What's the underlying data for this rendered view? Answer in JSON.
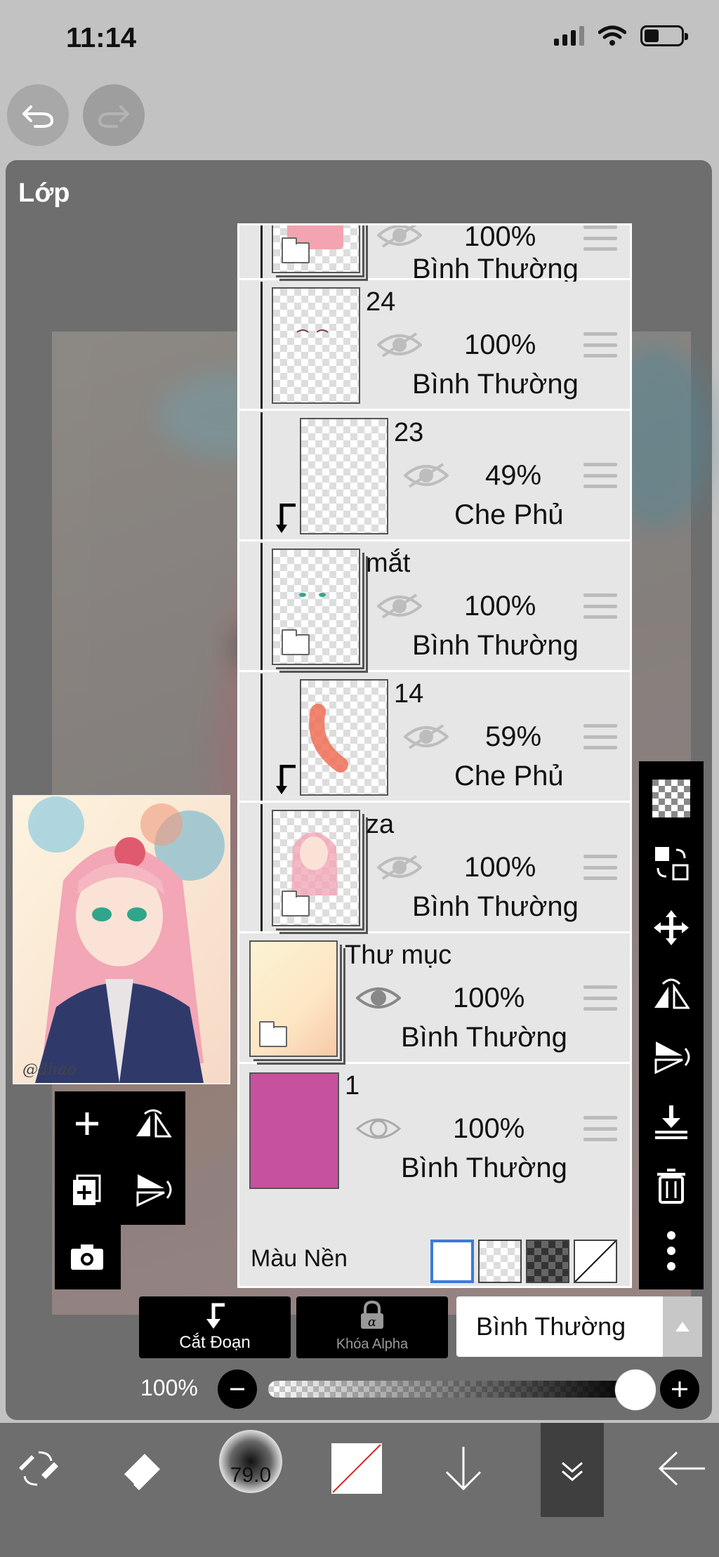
{
  "status": {
    "time": "11:14"
  },
  "panel": {
    "title": "Lớp"
  },
  "layers": [
    {
      "name": "",
      "opacity": "100%",
      "blend": "Bình Thường"
    },
    {
      "name": "24",
      "opacity": "100%",
      "blend": "Bình Thường"
    },
    {
      "name": "23",
      "opacity": "49%",
      "blend": "Che Phủ"
    },
    {
      "name": "mắt",
      "opacity": "100%",
      "blend": "Bình Thường"
    },
    {
      "name": "14",
      "opacity": "59%",
      "blend": "Che Phủ"
    },
    {
      "name": "za",
      "opacity": "100%",
      "blend": "Bình Thường"
    },
    {
      "name": "Thư mục",
      "opacity": "100%",
      "blend": "Bình Thường"
    },
    {
      "name": "1",
      "opacity": "100%",
      "blend": "Bình Thường"
    }
  ],
  "background": {
    "label": "Màu Nền"
  },
  "controls": {
    "clip_label": "Cắt Đoạn",
    "alpha_label": "Khóa Alpha",
    "blend_value": "Bình Thường",
    "opacity_value": "100%"
  },
  "bottom_bar": {
    "brush_size": "79.0"
  },
  "colors": {
    "layer1_fill": "#c5519f",
    "panel": "#6e6e6e",
    "list_bg": "#e6e6e6"
  },
  "nav_thumb": {
    "signature": "@dhao"
  }
}
